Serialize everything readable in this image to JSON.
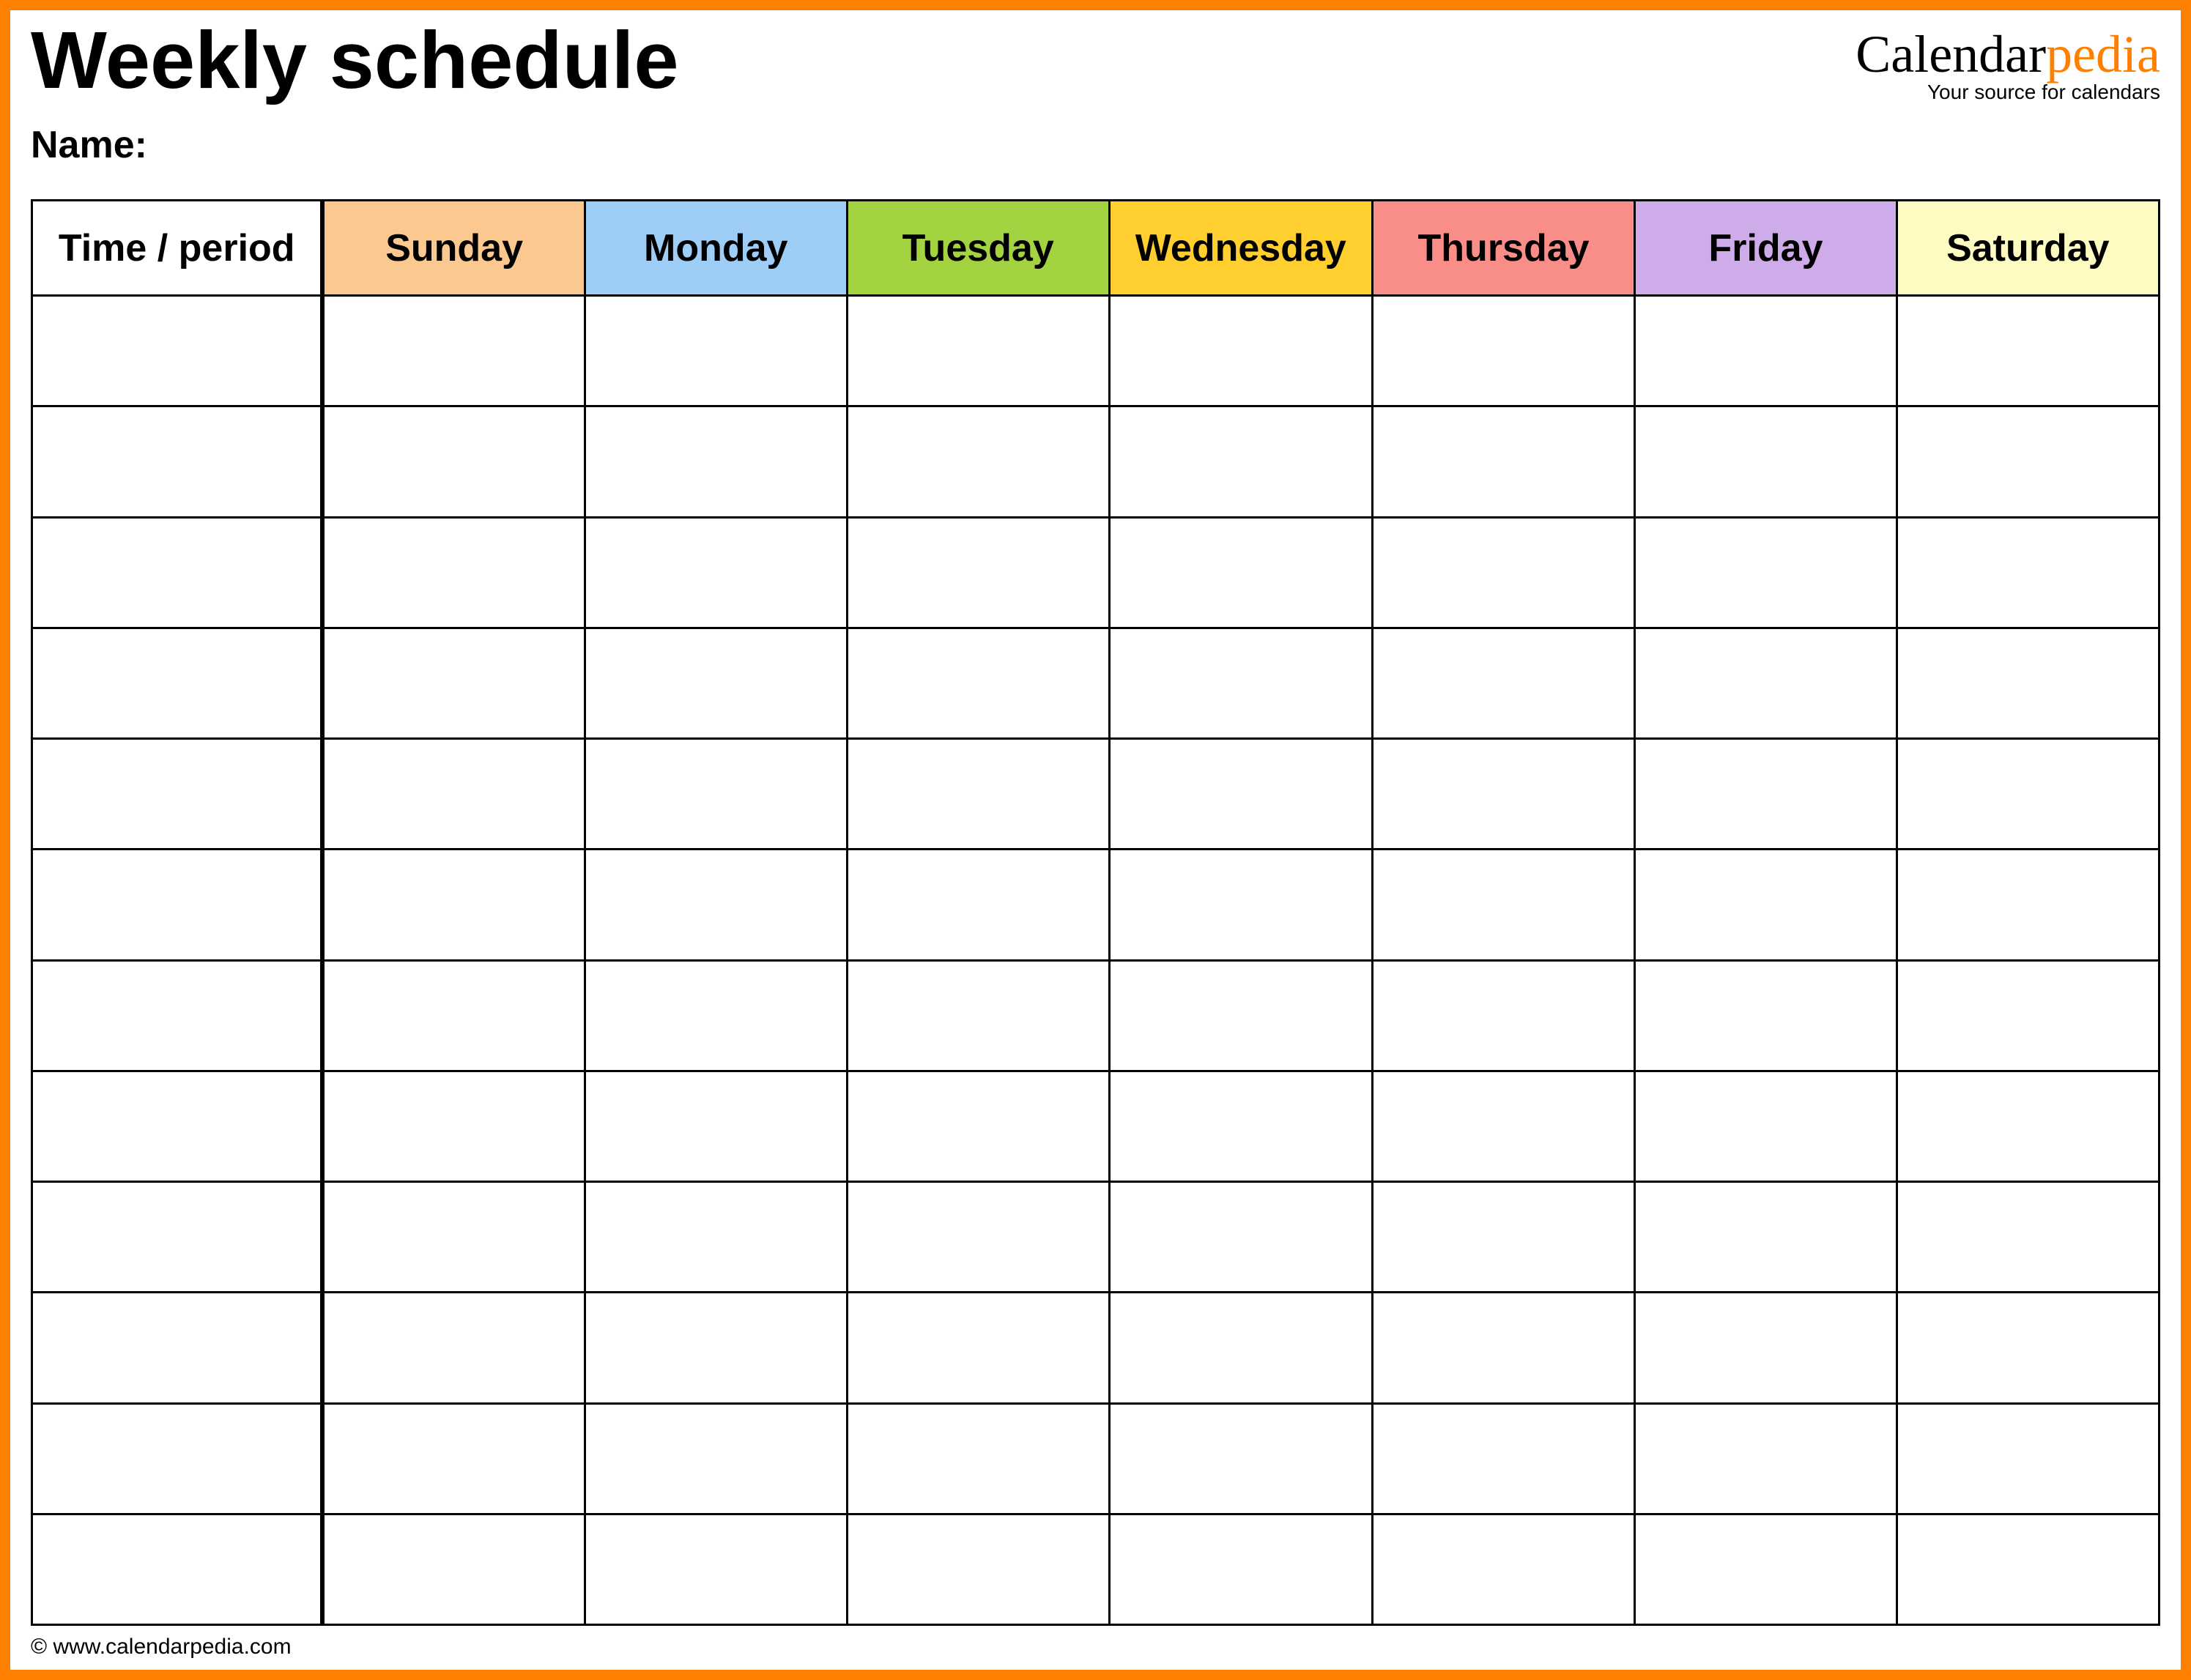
{
  "header": {
    "title": "Weekly schedule",
    "name_label": "Name:",
    "brand_prefix": "Calendar",
    "brand_suffix": "pedia",
    "brand_tagline": "Your source for calendars"
  },
  "table": {
    "columns": [
      {
        "label": "Time / period",
        "color": "#ffffff"
      },
      {
        "label": "Sunday",
        "color": "#fbc98f"
      },
      {
        "label": "Monday",
        "color": "#9ecdf6"
      },
      {
        "label": "Tuesday",
        "color": "#a3d341"
      },
      {
        "label": "Wednesday",
        "color": "#ffcf2f"
      },
      {
        "label": "Thursday",
        "color": "#f98e89"
      },
      {
        "label": "Friday",
        "color": "#ceabe9"
      },
      {
        "label": "Saturday",
        "color": "#fdfac2"
      }
    ],
    "row_count": 12
  },
  "footer": {
    "copyright": "© www.calendarpedia.com"
  }
}
